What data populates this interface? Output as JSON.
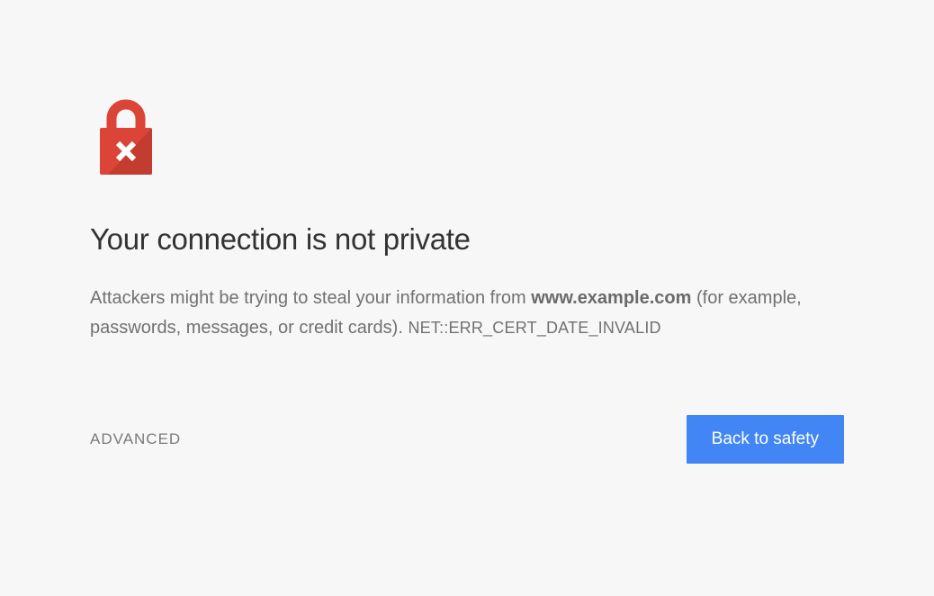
{
  "warning": {
    "heading": "Your connection is not private",
    "description_prefix": "Attackers might be trying to steal your information from ",
    "domain": "www.example.com",
    "description_suffix": " (for example, passwords, messages, or credit cards). ",
    "error_code": "NET::ERR_CERT_DATE_INVALID"
  },
  "buttons": {
    "advanced": "ADVANCED",
    "back_to_safety": "Back to safety"
  }
}
